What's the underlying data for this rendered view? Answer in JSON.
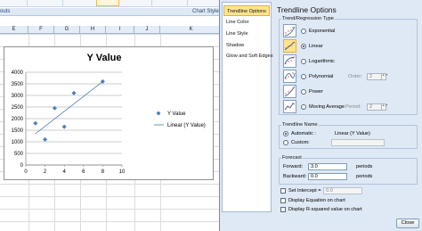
{
  "excel": {
    "group_labels": [
      "outs",
      "Chart Style"
    ],
    "column_headers": [
      "E",
      "F",
      "G",
      "H",
      "I",
      "J",
      "K"
    ]
  },
  "chart": {
    "legend": {
      "marker_label": "Y Value",
      "trendline_label": "Linear (Y Value)"
    },
    "colors": {
      "marker": "#4a7ebb",
      "trendline": "#4a7ebb"
    }
  },
  "chart_data": {
    "type": "scatter",
    "title": "Y Value",
    "xlim": [
      0,
      10
    ],
    "ylim": [
      0,
      4000
    ],
    "x_ticks": [
      0,
      2,
      4,
      6,
      8,
      10
    ],
    "y_ticks": [
      0,
      500,
      1000,
      1500,
      2000,
      2500,
      3000,
      3500,
      4000
    ],
    "series": [
      {
        "name": "Y Value",
        "x": [
          1,
          2,
          3,
          4,
          5,
          8
        ],
        "y": [
          1800,
          1100,
          2450,
          1650,
          3100,
          3600
        ]
      },
      {
        "name": "Linear (Y Value)",
        "type": "line",
        "x": [
          1,
          8
        ],
        "y": [
          1350,
          3600
        ]
      }
    ],
    "legend_position": "right",
    "grid": "horizontal"
  },
  "dialog": {
    "nav_items": [
      "Trendline Options",
      "Line Color",
      "Line Style",
      "Shadow",
      "Glow and Soft Edges"
    ],
    "heading": "Trendline Options",
    "regression_group": "Trend/Regression Type",
    "types": [
      {
        "label": "Exponential",
        "selected": false
      },
      {
        "label": "Linear",
        "selected": true
      },
      {
        "label": "Logarithmic",
        "selected": false
      },
      {
        "label": "Polynomial",
        "selected": false
      },
      {
        "label": "Power",
        "selected": false
      },
      {
        "label": "Moving Average",
        "selected": false
      }
    ],
    "order_label": "Order:",
    "order_value": "2",
    "period_label": "Period:",
    "period_value": "2",
    "name_group": "Trendline Name",
    "name_automatic": "Automatic :",
    "name_automatic_value": "Linear (Y Value)",
    "name_custom": "Custom:",
    "forecast_group": "Forecast",
    "forward_label": "Forward:",
    "forward_value": "3.0",
    "forward_unit": "periods",
    "backward_label": "Backward:",
    "backward_value": "0.0",
    "backward_unit": "periods",
    "intercept_label": "Set Intercept =",
    "intercept_value": "0.0",
    "display_equation": "Display Equation on chart",
    "display_rsquared": "Display R-squared value on chart",
    "close_label": "Close"
  }
}
